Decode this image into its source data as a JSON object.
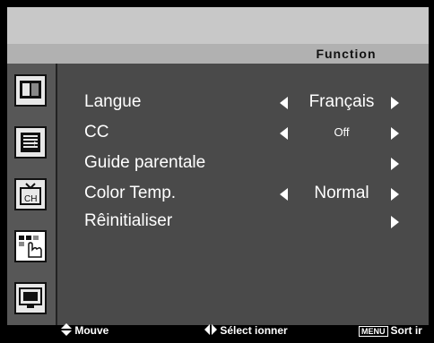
{
  "header": {
    "tab_title": "Function"
  },
  "sidebar": {
    "items": [
      {
        "icon": "picture-icon"
      },
      {
        "icon": "audio-icon"
      },
      {
        "icon": "channel-icon"
      },
      {
        "icon": "function-icon",
        "active": true
      },
      {
        "icon": "display-icon"
      }
    ]
  },
  "menu": {
    "rows": [
      {
        "label": "Langue",
        "value": "Français"
      },
      {
        "label": "CC",
        "value": "Off"
      },
      {
        "label": "Guide parentale",
        "value": ""
      },
      {
        "label": "Color Temp.",
        "value": "Normal"
      },
      {
        "label": "Rêinitialiser",
        "value": ""
      }
    ]
  },
  "footer": {
    "move_label": "Mouve",
    "select_label": "Sélect ionner",
    "menu_key": "MENU",
    "exit_label": "Sort ir"
  }
}
